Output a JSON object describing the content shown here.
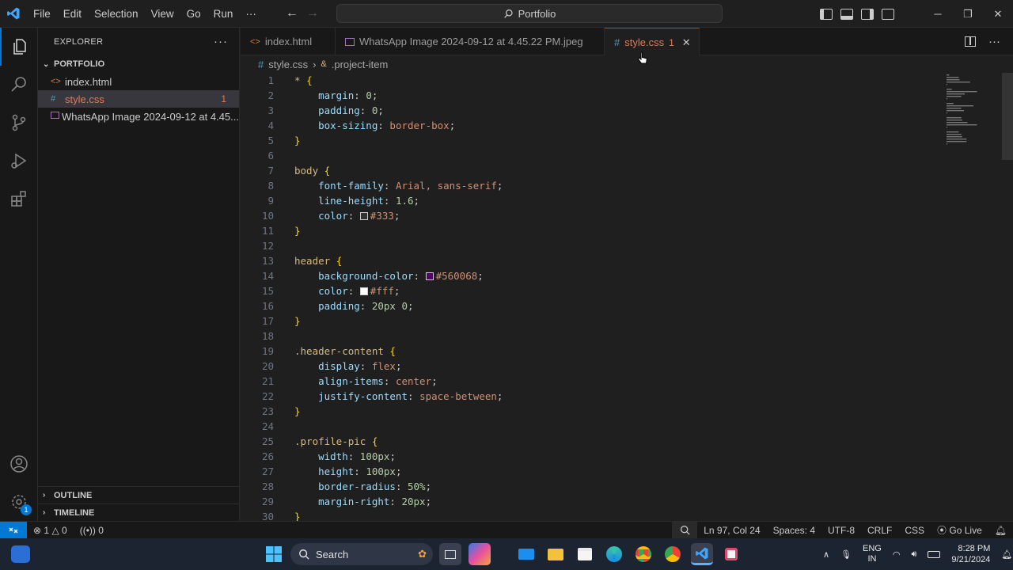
{
  "menu": [
    "File",
    "Edit",
    "Selection",
    "View",
    "Go",
    "Run",
    "···"
  ],
  "command_center": "Portfolio",
  "explorer": {
    "title": "EXPLORER",
    "folder": "PORTFOLIO",
    "files": [
      {
        "name": "index.html",
        "icon": "<>",
        "color": "#e37933",
        "badge": ""
      },
      {
        "name": "style.css",
        "icon": "#",
        "color": "#519aba",
        "badge": "1"
      },
      {
        "name": "WhatsApp Image 2024-09-12 at 4.45...",
        "icon": "img",
        "color": "#a074c4",
        "badge": ""
      }
    ],
    "outline": "OUTLINE",
    "timeline": "TIMELINE"
  },
  "tabs": [
    {
      "label": "index.html",
      "icon": "<>"
    },
    {
      "label": "WhatsApp Image 2024-09-12 at 4.45.22 PM.jpeg",
      "icon": "img"
    },
    {
      "label": "style.css",
      "icon": "#",
      "badge": "1"
    }
  ],
  "breadcrumb": {
    "file": "style.css",
    "symbol": ".project-item"
  },
  "code": [
    [
      [
        "sel",
        "* "
      ],
      [
        "brace",
        "{"
      ]
    ],
    [
      [
        "prop",
        "    margin"
      ],
      [
        "punc",
        ": "
      ],
      [
        "num",
        "0"
      ],
      [
        "punc",
        ";"
      ]
    ],
    [
      [
        "prop",
        "    padding"
      ],
      [
        "punc",
        ": "
      ],
      [
        "num",
        "0"
      ],
      [
        "punc",
        ";"
      ]
    ],
    [
      [
        "prop",
        "    box-sizing"
      ],
      [
        "punc",
        ": "
      ],
      [
        "val",
        "border-box"
      ],
      [
        "punc",
        ";"
      ]
    ],
    [
      [
        "brace",
        "}"
      ]
    ],
    [],
    [
      [
        "sel",
        "body "
      ],
      [
        "brace",
        "{"
      ]
    ],
    [
      [
        "prop",
        "    font-family"
      ],
      [
        "punc",
        ": "
      ],
      [
        "val",
        "Arial, sans-serif"
      ],
      [
        "punc",
        ";"
      ]
    ],
    [
      [
        "prop",
        "    line-height"
      ],
      [
        "punc",
        ": "
      ],
      [
        "num",
        "1.6"
      ],
      [
        "punc",
        ";"
      ]
    ],
    [
      [
        "prop",
        "    color"
      ],
      [
        "punc",
        ": "
      ],
      [
        "sw",
        "#333333"
      ],
      [
        "val",
        "#333"
      ],
      [
        "punc",
        ";"
      ]
    ],
    [
      [
        "brace",
        "}"
      ]
    ],
    [],
    [
      [
        "sel",
        "header "
      ],
      [
        "brace",
        "{"
      ]
    ],
    [
      [
        "prop",
        "    background-color"
      ],
      [
        "punc",
        ": "
      ],
      [
        "sw",
        "#560068"
      ],
      [
        "val",
        "#560068"
      ],
      [
        "punc",
        ";"
      ]
    ],
    [
      [
        "prop",
        "    color"
      ],
      [
        "punc",
        ": "
      ],
      [
        "sw",
        "#ffffff"
      ],
      [
        "val",
        "#fff"
      ],
      [
        "punc",
        ";"
      ]
    ],
    [
      [
        "prop",
        "    padding"
      ],
      [
        "punc",
        ": "
      ],
      [
        "num",
        "20px 0"
      ],
      [
        "punc",
        ";"
      ]
    ],
    [
      [
        "brace",
        "}"
      ]
    ],
    [],
    [
      [
        "sel",
        ".header-content "
      ],
      [
        "brace",
        "{"
      ]
    ],
    [
      [
        "prop",
        "    display"
      ],
      [
        "punc",
        ": "
      ],
      [
        "val",
        "flex"
      ],
      [
        "punc",
        ";"
      ]
    ],
    [
      [
        "prop",
        "    align-items"
      ],
      [
        "punc",
        ": "
      ],
      [
        "val",
        "center"
      ],
      [
        "punc",
        ";"
      ]
    ],
    [
      [
        "prop",
        "    justify-content"
      ],
      [
        "punc",
        ": "
      ],
      [
        "val",
        "space-between"
      ],
      [
        "punc",
        ";"
      ]
    ],
    [
      [
        "brace",
        "}"
      ]
    ],
    [],
    [
      [
        "sel",
        ".profile-pic "
      ],
      [
        "brace",
        "{"
      ]
    ],
    [
      [
        "prop",
        "    width"
      ],
      [
        "punc",
        ": "
      ],
      [
        "num",
        "100px"
      ],
      [
        "punc",
        ";"
      ]
    ],
    [
      [
        "prop",
        "    height"
      ],
      [
        "punc",
        ": "
      ],
      [
        "num",
        "100px"
      ],
      [
        "punc",
        ";"
      ]
    ],
    [
      [
        "prop",
        "    border-radius"
      ],
      [
        "punc",
        ": "
      ],
      [
        "num",
        "50%"
      ],
      [
        "punc",
        ";"
      ]
    ],
    [
      [
        "prop",
        "    margin-right"
      ],
      [
        "punc",
        ": "
      ],
      [
        "num",
        "20px"
      ],
      [
        "punc",
        ";"
      ]
    ],
    [
      [
        "brace",
        "}"
      ]
    ]
  ],
  "status": {
    "errors": "1",
    "warnings": "0",
    "ports": "0",
    "position": "Ln 97, Col 24",
    "spaces": "Spaces: 4",
    "encoding": "UTF-8",
    "eol": "CRLF",
    "language": "CSS",
    "golive": "Go Live"
  },
  "taskbar": {
    "search": "Search",
    "lang1": "ENG",
    "lang2": "IN",
    "time": "8:28 PM",
    "date": "9/21/2024"
  },
  "colors": {
    "accent": "#0078d4",
    "tab_active_text": "#e0795a"
  }
}
